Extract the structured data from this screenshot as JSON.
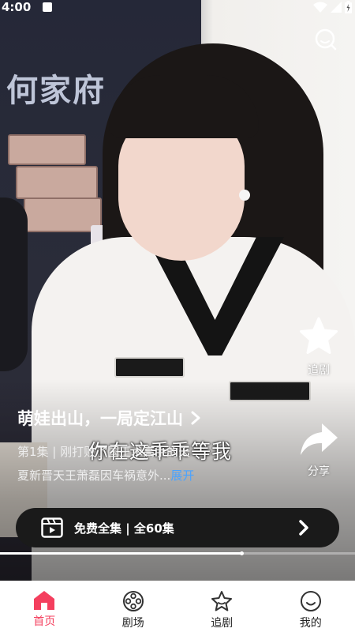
{
  "status_bar": {
    "time": "4:00"
  },
  "video": {
    "background_sign": "何家府",
    "subtitle": "你在这乖乖等我"
  },
  "actions": {
    "follow_label": "追剧",
    "share_label": "分享"
  },
  "drama": {
    "title": "萌娃出山，一局定江山",
    "episode_line": "第1集 | 刚打败了国王术高手的天",
    "description": "夏新晋天王萧磊因车祸意外...",
    "expand_label": "展开"
  },
  "watch_bar": {
    "label": "免费全集 | 全60集"
  },
  "progress": {
    "fraction": 0.68
  },
  "nav": {
    "items": [
      {
        "label": "首页",
        "icon": "home-icon",
        "active": true
      },
      {
        "label": "剧场",
        "icon": "film-reel-icon",
        "active": false
      },
      {
        "label": "追剧",
        "icon": "star-outline-icon",
        "active": false
      },
      {
        "label": "我的",
        "icon": "smiley-icon",
        "active": false
      }
    ]
  },
  "colors": {
    "accent": "#f43f5e",
    "expand": "#4aa3ff",
    "watch_bar_bg": "#1a1a1a"
  }
}
